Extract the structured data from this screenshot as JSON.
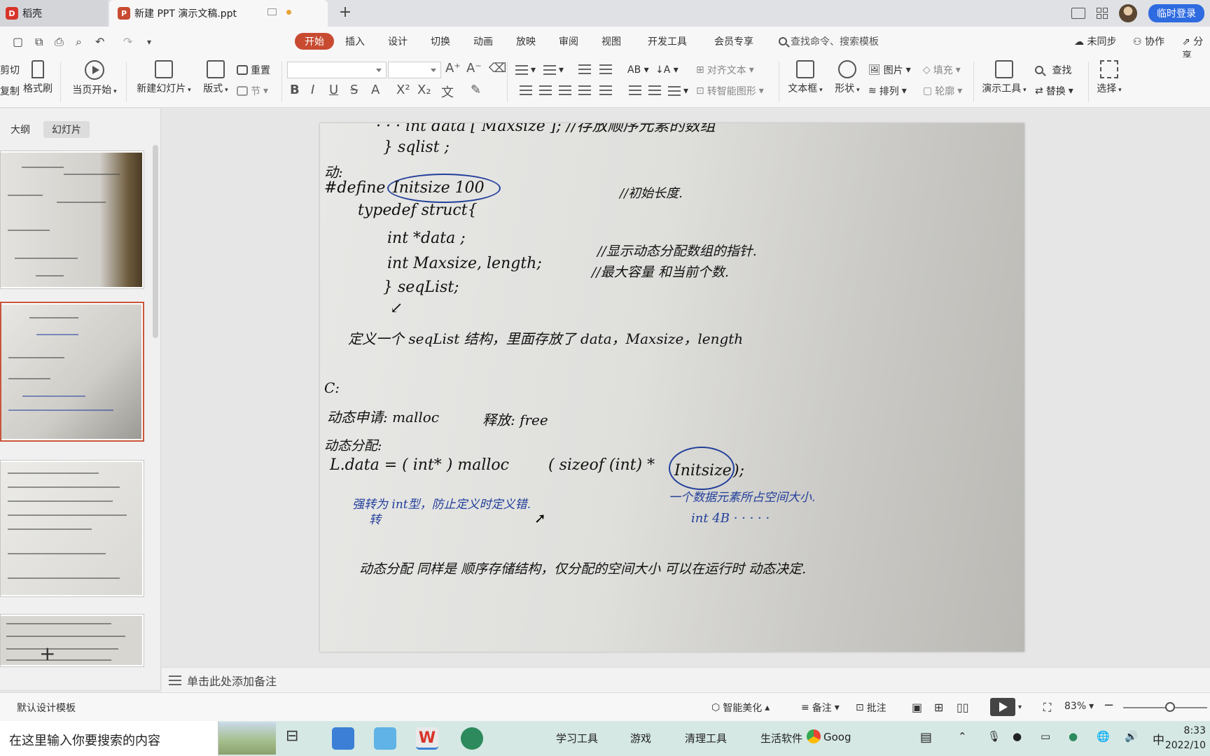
{
  "tabs": {
    "home": "稻壳",
    "document": "新建 PPT 演示文稿.ppt"
  },
  "title_right": {
    "login": "临时登录"
  },
  "menu": {
    "start": "开始",
    "items": [
      "插入",
      "设计",
      "切换",
      "动画",
      "放映",
      "审阅",
      "视图",
      "开发工具",
      "会员专享"
    ],
    "search": "查找命令、搜索模板",
    "sync": "未同步",
    "collab": "协作",
    "share": "分享"
  },
  "toolbar": {
    "cut": "剪切",
    "copy": "复制",
    "format_painter": "格式刷",
    "from_current": "当页开始",
    "new_slide": "新建幻灯片",
    "layout": "版式",
    "reset": "重置",
    "section": "节",
    "align_text": "对齐文本",
    "convert_smartart": "转智能图形",
    "textbox": "文本框",
    "shape": "形状",
    "picture": "图片",
    "arrange": "排列",
    "fill": "填充",
    "outline": "轮廓",
    "present_tool": "演示工具",
    "find": "查找",
    "replace": "替换",
    "select": "选择"
  },
  "panel": {
    "outline_tab": "大纲",
    "slides_tab": "幻灯片"
  },
  "slide_text": {
    "l1": "} sqlist ;",
    "l2": "动:",
    "l3a": "#define",
    "l3b": "Initsize   100",
    "l3c": "//初始长度.",
    "l4": "typedef  struct{",
    "l5": "int    *data ;",
    "l6": "int    Maxsize, length;",
    "l6c1": "//显示动态分配数组的指针.",
    "l6c2": "//最大容量 和当前个数.",
    "l7": "} seqList;",
    "l8": "定义一个 seqList 结构，里面存放了 data，Maxsize，length",
    "l9": "C:",
    "l10a": "动态申请: malloc",
    "l10b": "释放: free",
    "l11": "动态分配:",
    "l12a": "L.data = ( int* ) malloc",
    "l12b": "( sizeof (int) *",
    "l12c": "Initsize",
    "l12d": ");",
    "l13a": "强转为 int型，防止定义时定义错.",
    "l13b": "转",
    "l13c": "一个数据元素所占空间大小.",
    "l13d": "int   4B · · · · ·",
    "l14": "动态分配 同样是 顺序存储结构，仅分配的空间大小 可以在运行时 动态决定."
  },
  "notes": {
    "placeholder": "单击此处添加备注"
  },
  "status": {
    "template": "默认设计模板",
    "beautify": "智能美化",
    "notes": "备注",
    "comment": "批注",
    "zoom": "83%"
  },
  "taskbar": {
    "search_placeholder": "在这里输入你要搜索的内容",
    "groups": [
      "学习工具",
      "游戏",
      "清理工具",
      "生活软件"
    ],
    "chrome_label": "Goog",
    "ime": "中",
    "time": "8:33",
    "date": "2022/10"
  },
  "colors": {
    "accent_red": "#c84b31",
    "login_blue": "#2f6be0",
    "ink_blue": "#223f9a"
  }
}
